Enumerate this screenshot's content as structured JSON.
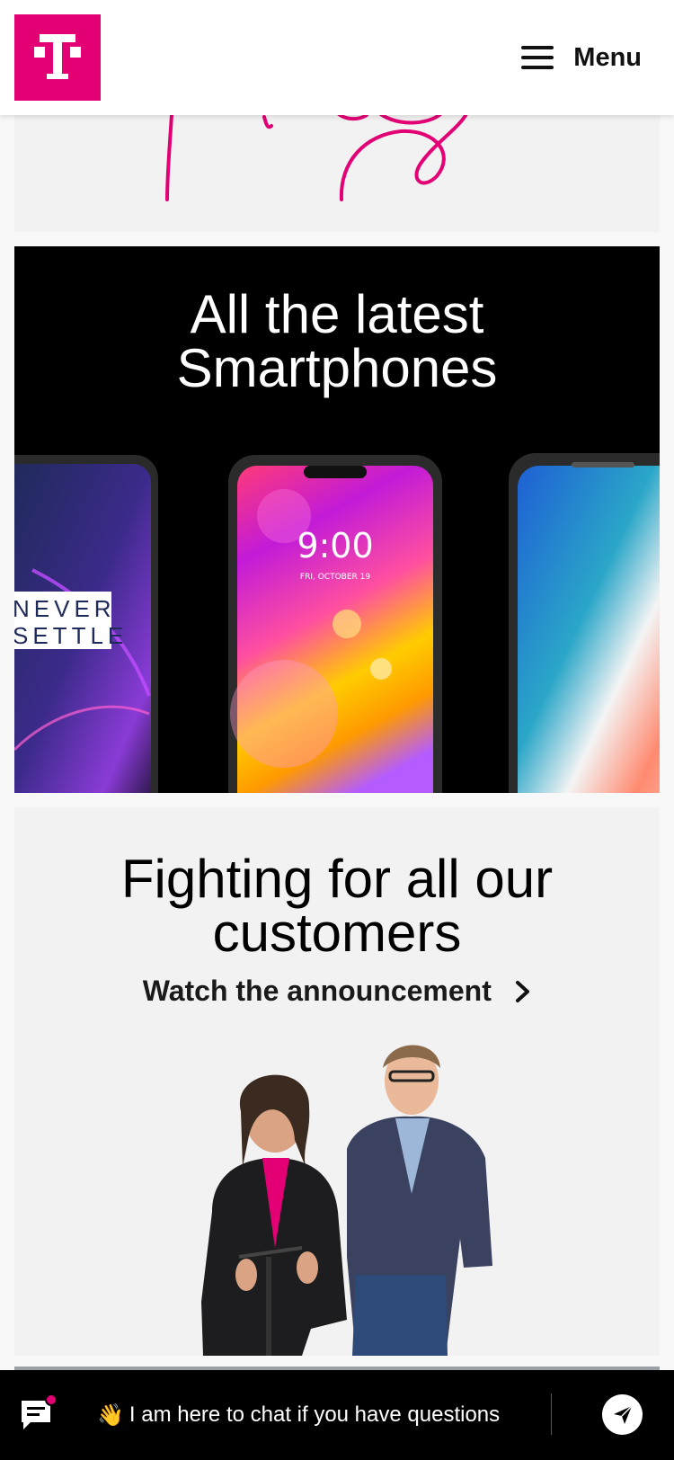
{
  "header": {
    "logo_letter": "T",
    "menu_label": "Menu"
  },
  "cards": {
    "smartphones": {
      "title_line1": "All the latest",
      "title_line2": "Smartphones",
      "phone_left_text_1": "NEVER",
      "phone_left_text_2": "SETTLE",
      "phone_center_time": "9:00",
      "phone_center_date": "FRI, OCTOBER 19"
    },
    "fighting": {
      "title_line1": "Fighting for all our",
      "title_line2": "customers",
      "link_label": "Watch the announcement"
    }
  },
  "chat": {
    "emoji": "👋",
    "message": "I am here to chat if you have questions"
  },
  "colors": {
    "brand_magenta": "#e20074",
    "card_gray": "#f2f2f2"
  },
  "icons": {
    "menu": "hamburger-icon",
    "chat": "chat-bubble-icon",
    "send": "send-arrow-icon",
    "link": "chevron-right-icon"
  }
}
